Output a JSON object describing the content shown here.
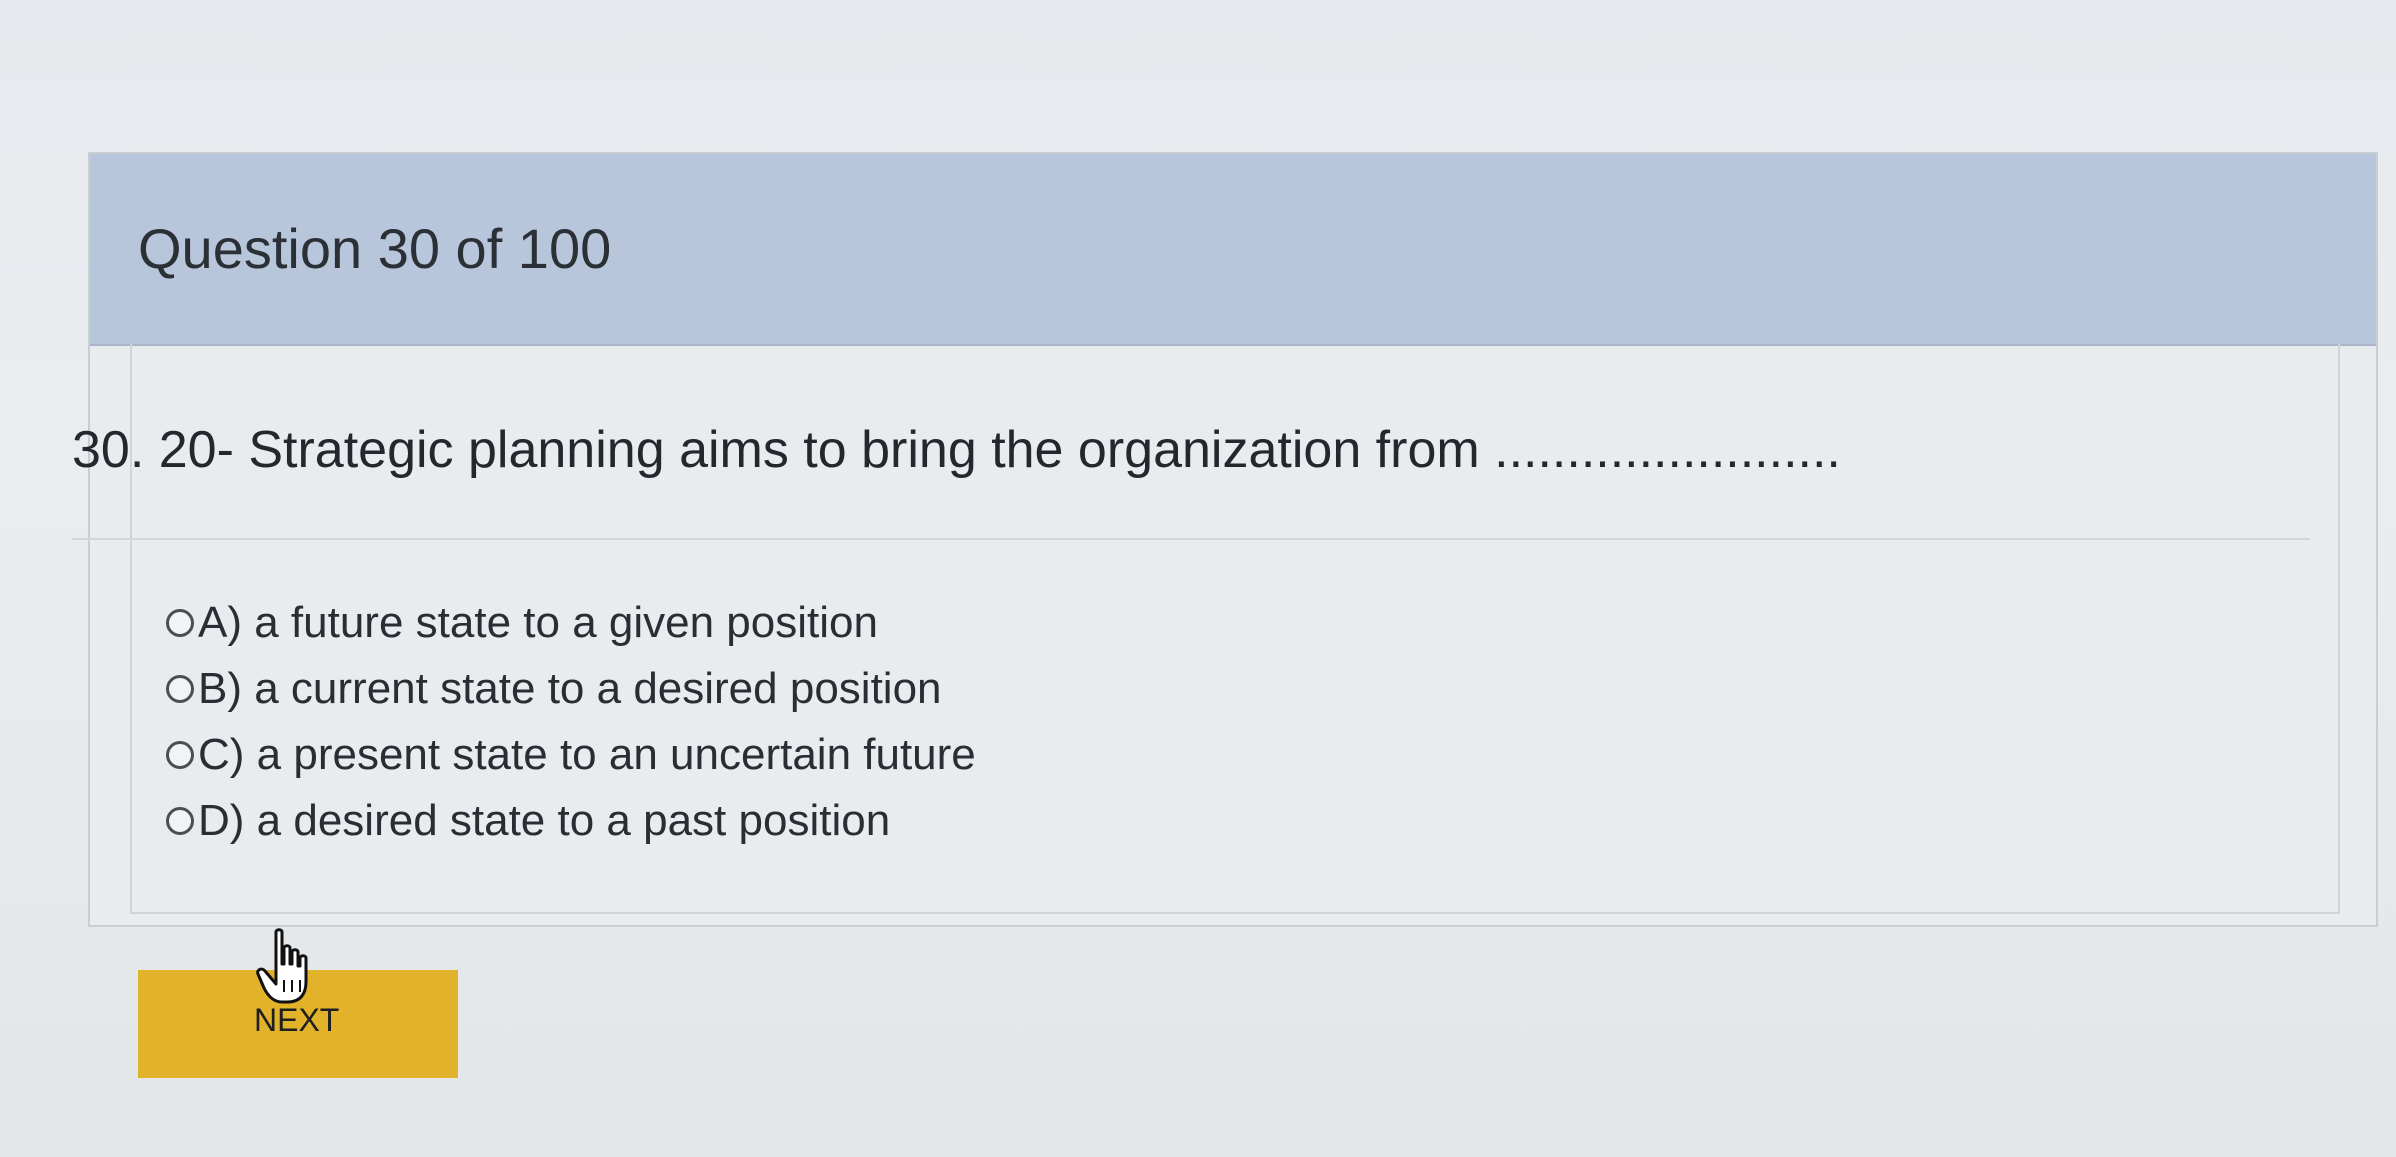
{
  "header": {
    "title": "Question 30 of 100"
  },
  "question": {
    "text": "30. 20- Strategic planning aims to bring the organization from ........................"
  },
  "options": [
    {
      "label": "A) a future state to a given position"
    },
    {
      "label": "B) a current state to a desired position"
    },
    {
      "label": "C) a present state to an uncertain future"
    },
    {
      "label": "D) a desired state to a past position"
    }
  ],
  "footer": {
    "next_label": "NEXT"
  },
  "colors": {
    "header_bg": "#b8c6dc",
    "next_button_bg": "#e2b22b"
  },
  "icons": {
    "cursor": "hand-pointer-icon",
    "radio": "radio-button-icon"
  }
}
